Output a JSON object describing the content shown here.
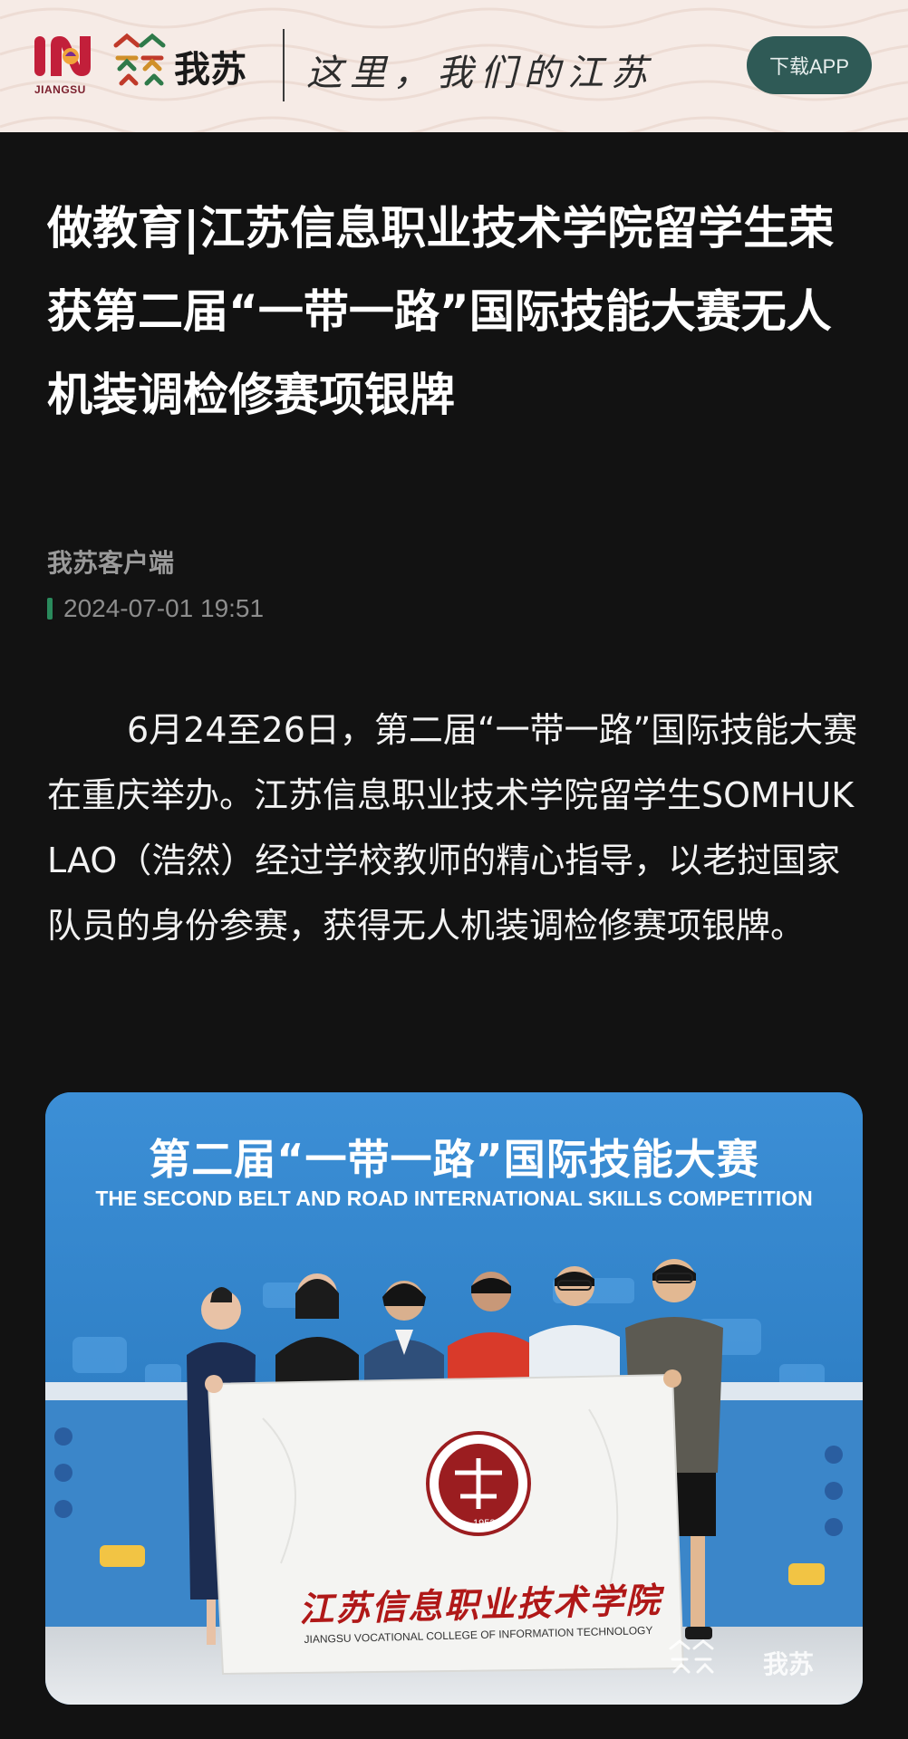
{
  "header": {
    "logo_label": "JIANGSU",
    "brand_name": "我苏",
    "slogan": "这里，我们的江苏",
    "download_label": "下载APP"
  },
  "article": {
    "title": "做教育|江苏信息职业技术学院留学生荣获第二届“一带一路”国际技能大赛无人机装调检修赛项银牌",
    "source": "我苏客户端",
    "published_at": "2024-07-01 19:51",
    "body": "6月24至26日，第二届“一带一路”国际技能大赛在重庆举办。江苏信息职业技术学院留学生SOMHUK LAO（浩然）经过学校教师的精心指导，以老挝国家队员的身份参赛，获得无人机装调检修赛项银牌。"
  },
  "photo": {
    "backdrop_title_cn": "第二届“一带一路”国际技能大赛",
    "backdrop_title_en": "THE SECOND BELT AND ROAD INTERNATIONAL SKILLS COMPETITION",
    "banner_cn": "江苏信息职业技术学院",
    "banner_en": "JIANGSU VOCATIONAL COLLEGE OF INFORMATION TECHNOLOGY",
    "seal_year": "1953",
    "watermark": "我苏"
  },
  "colors": {
    "page_bg": "#121212",
    "header_bg": "#f6ebe6",
    "button_bg": "#2f5a56",
    "time_marker": "#2a8a5c",
    "backdrop_blue": "#2a7ec4",
    "banner_red": "#b01818"
  },
  "icons": {
    "logo": "in-jiangsu-logo",
    "mark": "wosu-mark-icon"
  }
}
